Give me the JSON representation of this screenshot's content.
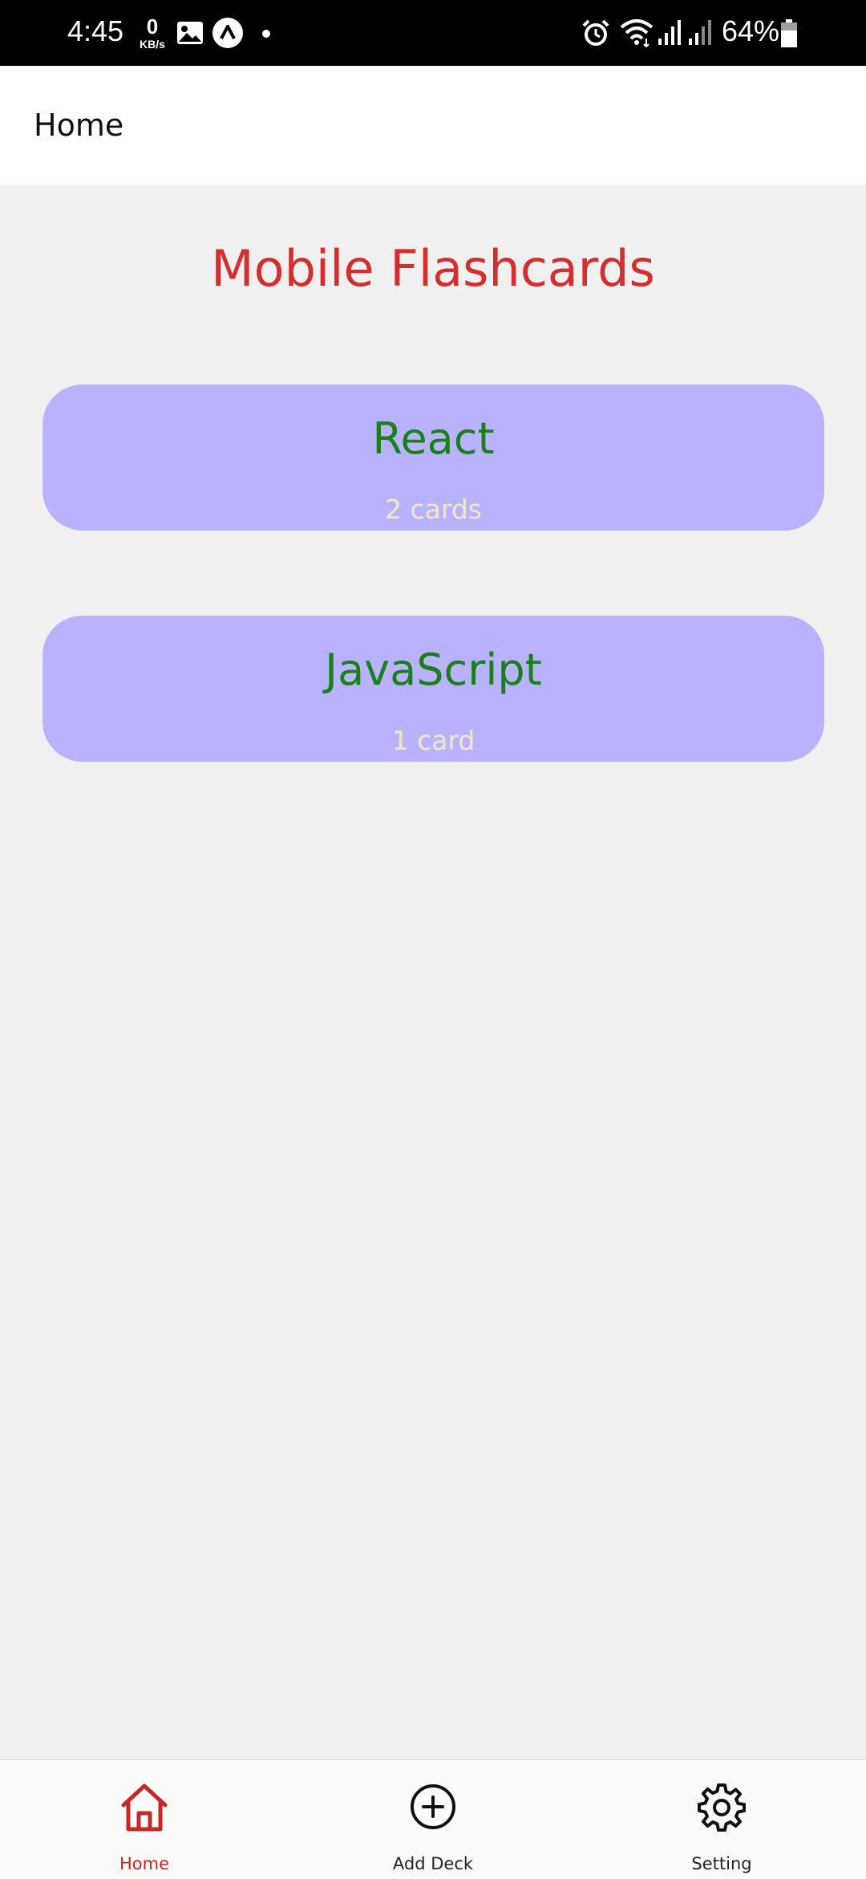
{
  "status_bar": {
    "time": "4:45",
    "net_speed_value": "0",
    "net_speed_unit": "KB/s",
    "battery": "64%"
  },
  "header": {
    "title": "Home"
  },
  "main": {
    "title": "Mobile Flashcards",
    "decks": [
      {
        "name": "React",
        "count": "2 cards"
      },
      {
        "name": "JavaScript",
        "count": "1 card"
      }
    ]
  },
  "tabbar": {
    "tabs": [
      {
        "label": "Home",
        "icon": "home-icon",
        "active": true
      },
      {
        "label": "Add Deck",
        "icon": "plus-circle-icon",
        "active": false
      },
      {
        "label": "Setting",
        "icon": "gear-icon",
        "active": false
      }
    ]
  },
  "colors": {
    "title_red": "#d32f2f",
    "card_bg": "#b9b3ff",
    "deck_name_green": "#1b7f1b",
    "deck_count": "#f0e6c6",
    "active_tab": "#c62828"
  }
}
